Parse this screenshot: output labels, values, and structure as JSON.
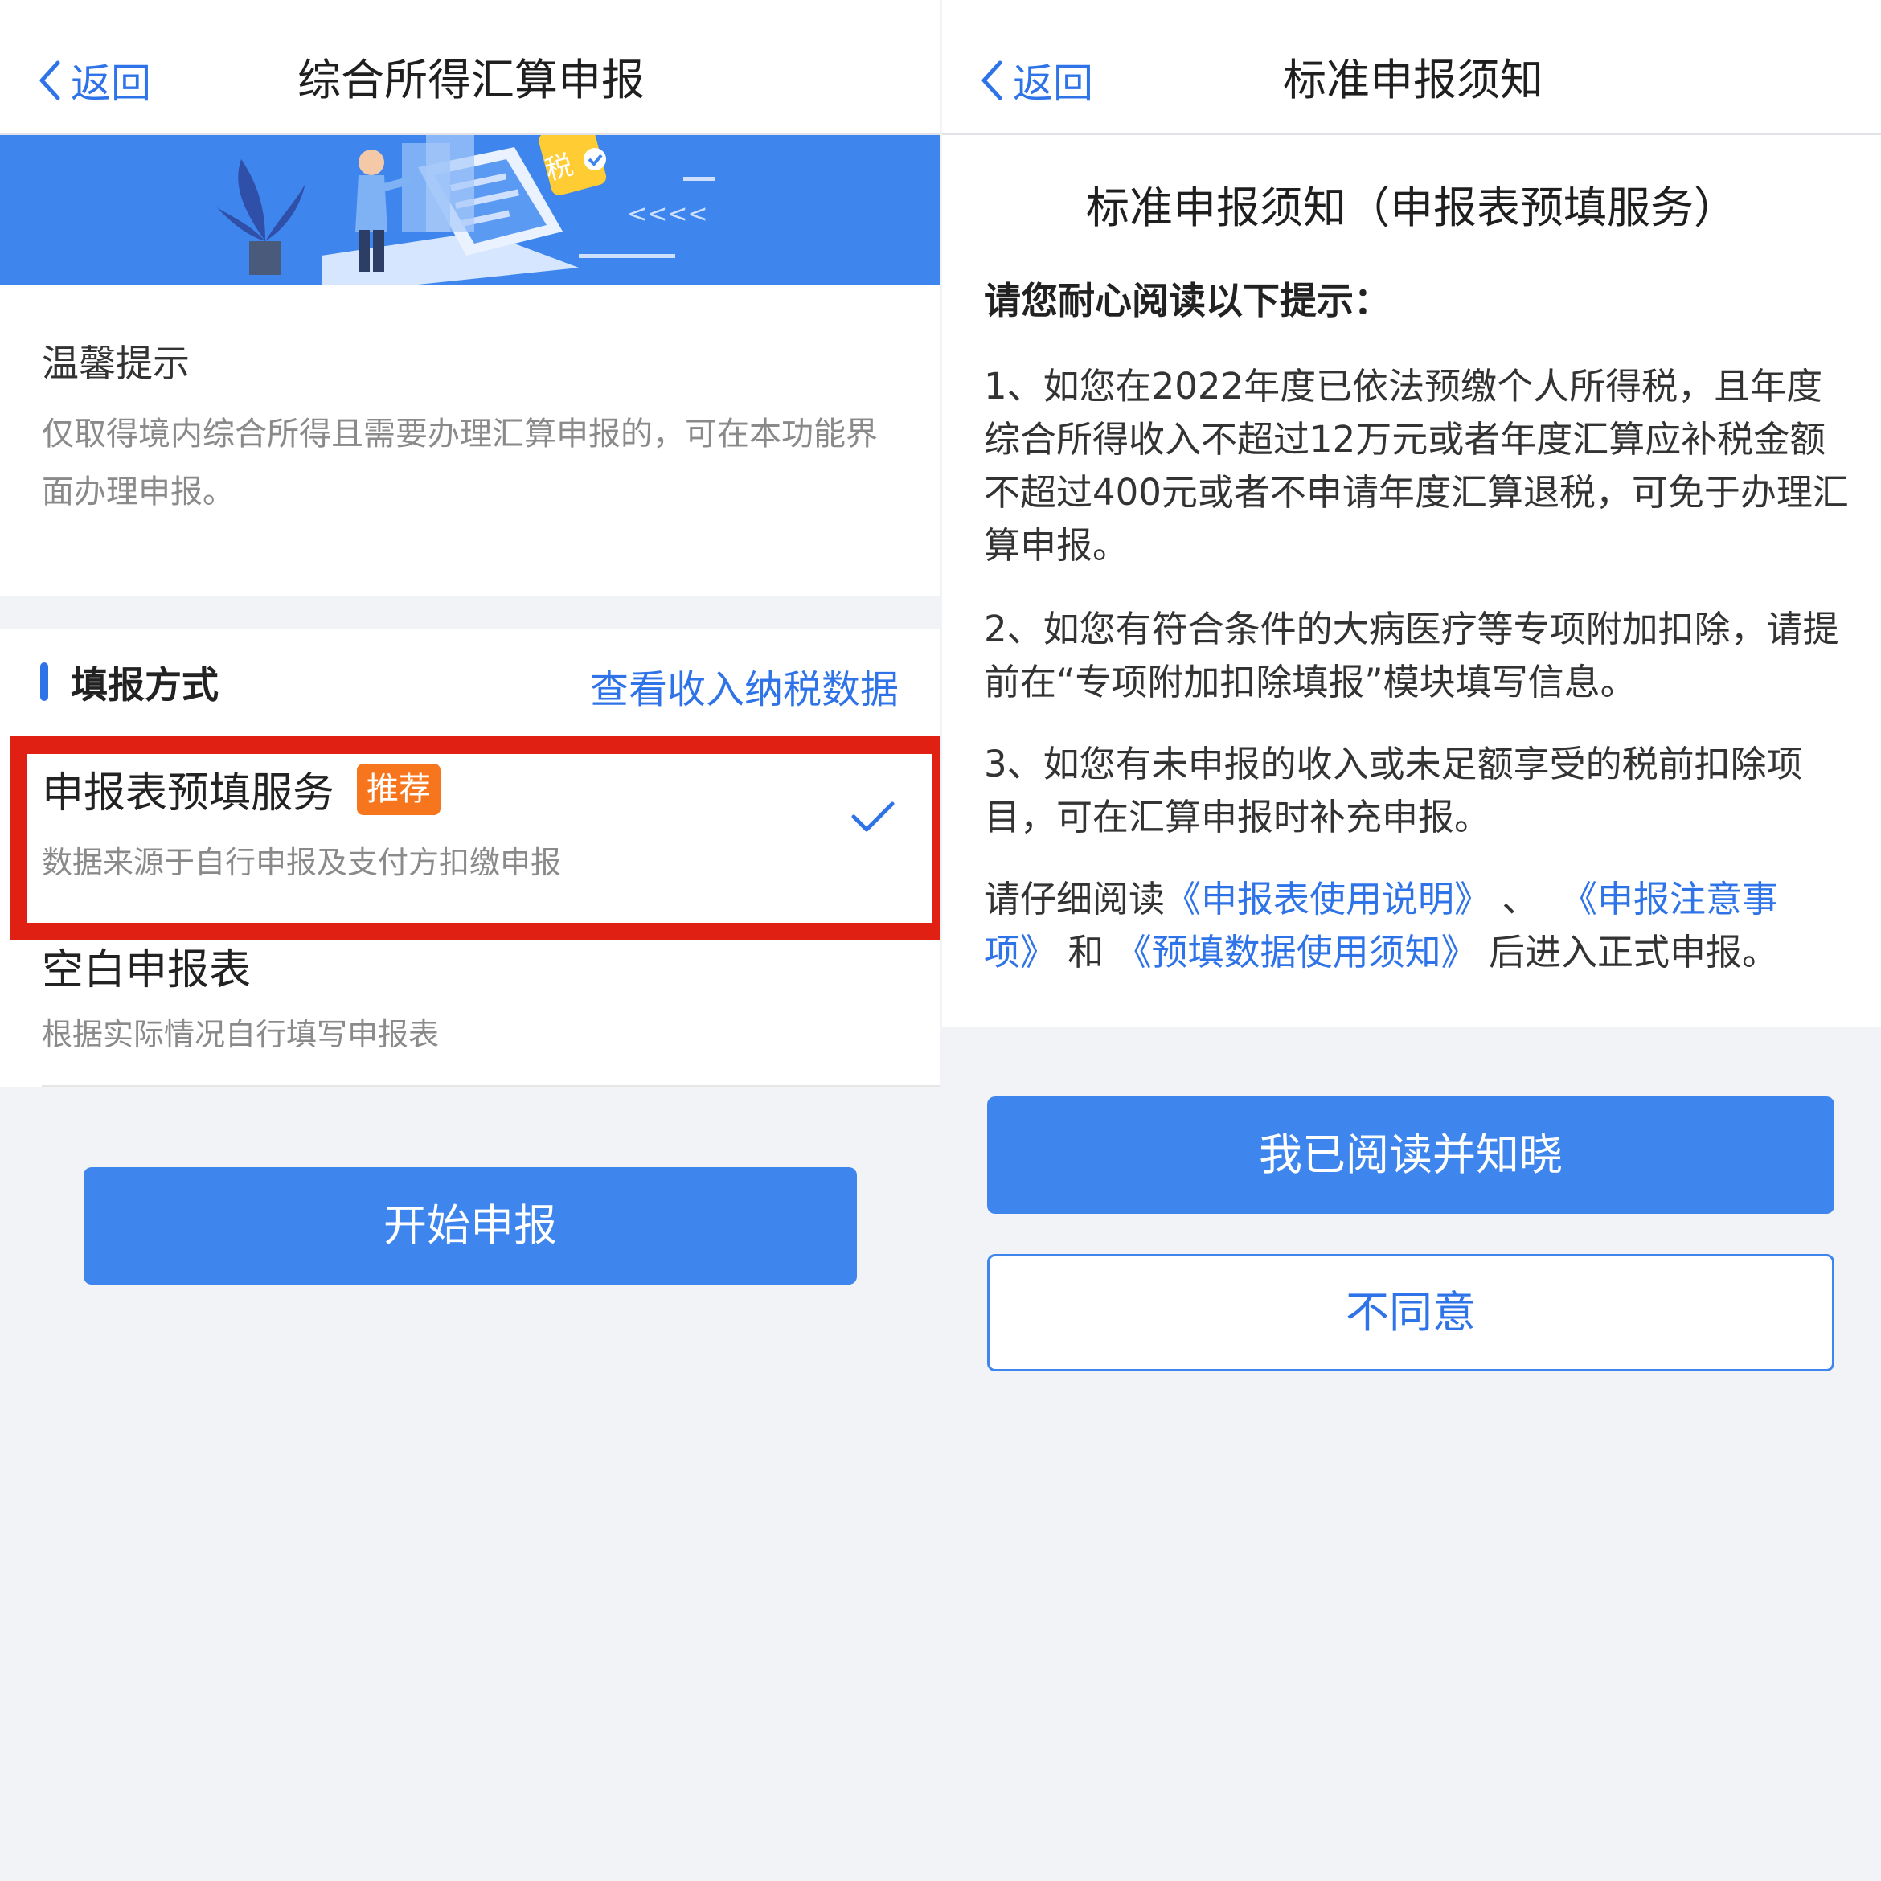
{
  "left": {
    "nav": {
      "back_label": "返回",
      "title": "综合所得汇算申报"
    },
    "banner": {
      "tax_badge": "税",
      "arrows": "<<<<"
    },
    "tips": {
      "title": "温馨提示",
      "text": "仅取得境内综合所得且需要办理汇算申报的，可在本功能界面办理申报。"
    },
    "method": {
      "title": "填报方式",
      "view_link": "查看收入纳税数据",
      "options": [
        {
          "title": "申报表预填服务",
          "badge": "推荐",
          "subtitle": "数据来源于自行申报及支付方扣缴申报",
          "selected": true
        },
        {
          "title": "空白申报表",
          "subtitle": "根据实际情况自行填写申报表",
          "selected": false
        }
      ]
    },
    "start_button": "开始申报"
  },
  "right": {
    "nav": {
      "back_label": "返回",
      "title": "标准申报须知"
    },
    "heading": "标准申报须知（申报表预填服务）",
    "intro": "请您耐心阅读以下提示：",
    "items": [
      "1、如您在2022年度已依法预缴个人所得税，且年度综合所得收入不超过12万元或者年度汇算应补税金额不超过400元或者不申请年度汇算退税，可免于办理汇算申报。",
      "2、如您有符合条件的大病医疗等专项附加扣除，请提前在“专项附加扣除填报”模块填写信息。",
      "3、如您有未申报的收入或未足额享受的税前扣除项目，可在汇算申报时补充申报。"
    ],
    "read_notice": {
      "prefix": "请仔细阅读",
      "link1": "《申报表使用说明》",
      "sep1": "、",
      "link2": "《申报注意事项》",
      "sep2": "和",
      "link3": "《预填数据使用须知》",
      "suffix": "后进入正式申报。"
    },
    "agree_button": "我已阅读并知晓",
    "disagree_button": "不同意"
  },
  "colors": {
    "primary": "#3e86ee",
    "link": "#2f73e8",
    "highlight": "#e02012",
    "badge": "#f7761d",
    "background": "#f2f3f7"
  },
  "icons": [
    "chevron-left-icon",
    "checkmark-icon"
  ]
}
